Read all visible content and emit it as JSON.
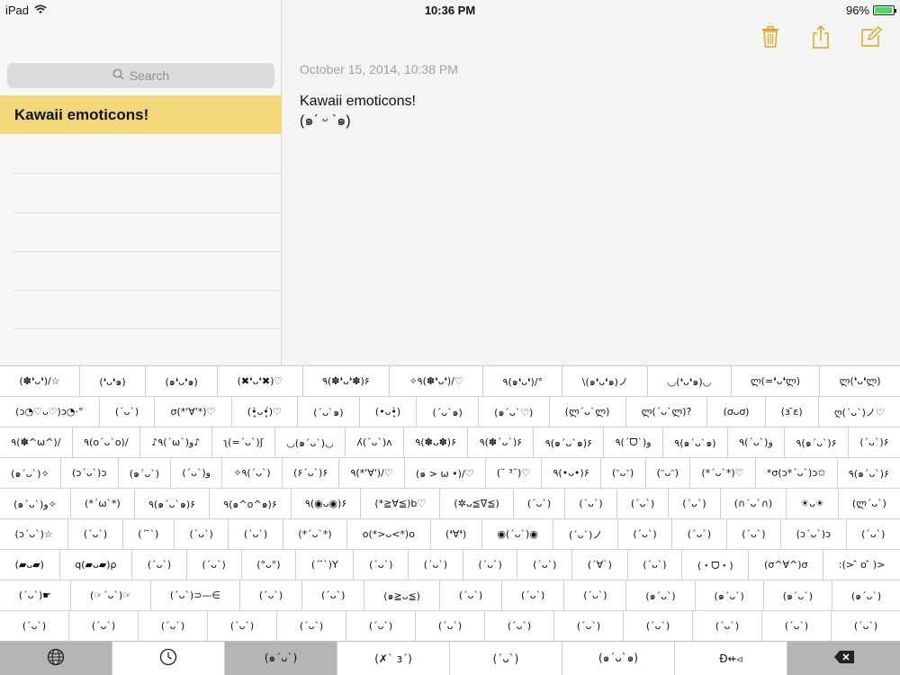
{
  "statusbar": {
    "device": "iPad",
    "time": "10:36 PM",
    "battery": "96%",
    "battery_level": 0.96
  },
  "sidebar": {
    "search_placeholder": "Search",
    "selected_note": "Kawaii emoticons!"
  },
  "note": {
    "date": "October 15, 2014, 10:38 PM",
    "title": "Kawaii emoticons!",
    "emoticon": "(๑ˊ ᵕ ˋ๑)"
  },
  "toolbar": {
    "trash": "trash-icon",
    "share": "share-icon",
    "compose": "compose-icon"
  },
  "keyboard": {
    "rows": [
      [
        "(✽❛ᴗ❛)/☆",
        "(❛ᴗ❛๑)",
        "(๑❛ᴗ❛๑)",
        "(✖❛ᴗ❛✖)♡",
        "٩(✽❛ᴗ❛✽)۶",
        "✧٩(✽❛ᴗ❛)/♡",
        "٩(๑❛ᴗ❛)/°",
        "\\(๑❛ᴗ❛๑)ノ",
        "◡(❛ᴗ❛๑)◡",
        "ლ(=❛ᴗ❛ლ)",
        "ლ(❛ᴗ❛ლ)"
      ],
      [
        "(ɔ◔♡ᴗ♡)ɔ◔·°",
        "(ˊᴗˋ)",
        "σ(*'∀'*)♡",
        "(•̥̀ᴗ•̥́)♡",
        "(ˊᴗˋ๑)",
        "(•ᴗ•̥̀)",
        "(ˊᴗˋ๑)",
        "(๑ˊᴗˋ♡)",
        "(ლˊᴗˋლ)",
        "ლ(ˊᴗˋლ)?",
        "(ơᴗơ)",
        "(з ̄ε)",
        "ღ(ˊᴗˋ)ノ♡"
      ],
      [
        "٩(✽^ω^)/",
        "٩(o´ᴗ`o)/",
        "♪٩(´ω`)و♪",
        "ʅ(=ˊᴗˋ)ʃ",
        "◡(๑ˊᴗˋ)◡",
        "ʎ(ˊᴗˋ)ʌ",
        "٩(✽ᴗ✽)۶",
        "٩(✽ˊᴗˋ)۶",
        "٩(๑ˊᴗˋ๑)۶",
        "٩(ˊᗜˋ)و",
        "٩(๑ˊᴗˋ๑)",
        "٩(ˊᴗˋ)و",
        "٩(๑ˊᴗˋ)۶",
        "(ˊᴗˋ)۶"
      ],
      [
        "(๑ˊᴗˋ)✧",
        "(ɔˊᴗˋ)ɔ",
        "(๑ˊᴗˋ)",
        "(ˊᴗˋ)و",
        "✧٩(ˊᴗˋ)",
        "(۶ˊᴗˋ)۶",
        "٩(*'∀')/♡",
        "(๑ > ω •)/♡",
        "(˘ ³˘)♡",
        "٩(•ᴗ•)۶",
        "(ᵔᴗᵔ)",
        "(ᵔᴗᵔ)",
        "(*ˊᴗˋ*)♡",
        "*σ(ɔ*ˊᴗˋ)ɔ✩",
        "٩(๑ˊᴗˋ)۶"
      ],
      [
        "(๑ˊᴗˋ)و✧",
        "(*ˊωˋ*)",
        "٩(๑ˊᴗˋ๑)۶",
        "٩(๑^o^๑)۶",
        "٩(◉ᴗ◉)۶",
        "(*≧∀≦)b♡",
        "(✲ᴗ≦∇≦)",
        "(ˊᴗˋ)",
        "(ˊᴗˋ)",
        "(ˊᴗˋ)",
        "(ˊᴗˋ)",
        "(∩ˊᴗˋ∩)",
        "☀ᴗ☀",
        "(ლˊᴗˋ)"
      ],
      [
        "(ɔˊᴗˋ)☆",
        "(ˊᴗˋ)",
        "(ˊ ̄ˋ)",
        "(ˊᴗˋ)",
        "(ˊᴗˋ)",
        "(*ˊᴗˋ*)",
        "o(*>ᴗ<*)o",
        "(❛∀❛)",
        "◉(ˊᴗˋ)◉",
        "(ˊᴗˋ)ノ",
        "(ˊᴗˋ)",
        "(ˊᴗˋ)",
        "(ˊᴗˋ)",
        "(ɔˊᴗˋ)ɔ",
        "(ˊᴗˋ)"
      ],
      [
        "(▰ᴗ▰)",
        "q(▰ᴗ▰)ρ",
        "(ˊᴗˋ)",
        "(ˊᴗˋ)",
        "(°ᴗ°)",
        "(ˊ ̄ˋ)Y",
        "(ˊᴗˋ)",
        "(ˊᴗˋ)",
        "(ˊᴗˋ)",
        "(ˊᴗˋ)",
        "(ˊ∀ˋ)",
        "(ˊᴗˋ)",
        "(・ᗜ・)",
        "(σ^∀^)σ",
        ":(> ̂ o ̂ )>"
      ],
      [
        "(ˊᴗˋ)☛",
        "(☞ˊᴗˋ)☞",
        "(ˊᴗˋ)⊃—∈",
        "(ˊᴗˋ)",
        "(ˊᴗˋ)",
        "(๑≧ᴗ≦)",
        "(ˊᴗˋ)",
        "(ˊᴗˋ)",
        "(ˊᴗˋ)",
        "(๑ˊᴗˋ)",
        "(๑ˊᴗˋ)",
        "(๑ˊᴗˋ)",
        "(๑ˊᴗˋ)"
      ],
      [
        "(ˊᴗˋ)",
        "(ˊᴗˋ)",
        "(ˊᴗˋ)",
        "(ˊᴗˋ)",
        "(ˊᴗˋ)",
        "(ˊᴗˋ)",
        "(ˊᴗˋ)",
        "(ˊᴗˋ)",
        "(ˊᴗˋ)",
        "(ˊᴗˋ)",
        "(ˊᴗˋ)",
        "(ˊᴗˋ)",
        "(ˊᴗˋ)"
      ]
    ]
  },
  "bottombar": {
    "globe": "globe-icon",
    "recent": "clock-icon",
    "keys": [
      "(๑ˊᴗˋ)",
      "(✗ˋ з´)",
      "(ˊᴗˋ)",
      "(๑ˊᴗˋ๑)",
      "Ð⇷◃"
    ],
    "delete": "delete-icon"
  }
}
